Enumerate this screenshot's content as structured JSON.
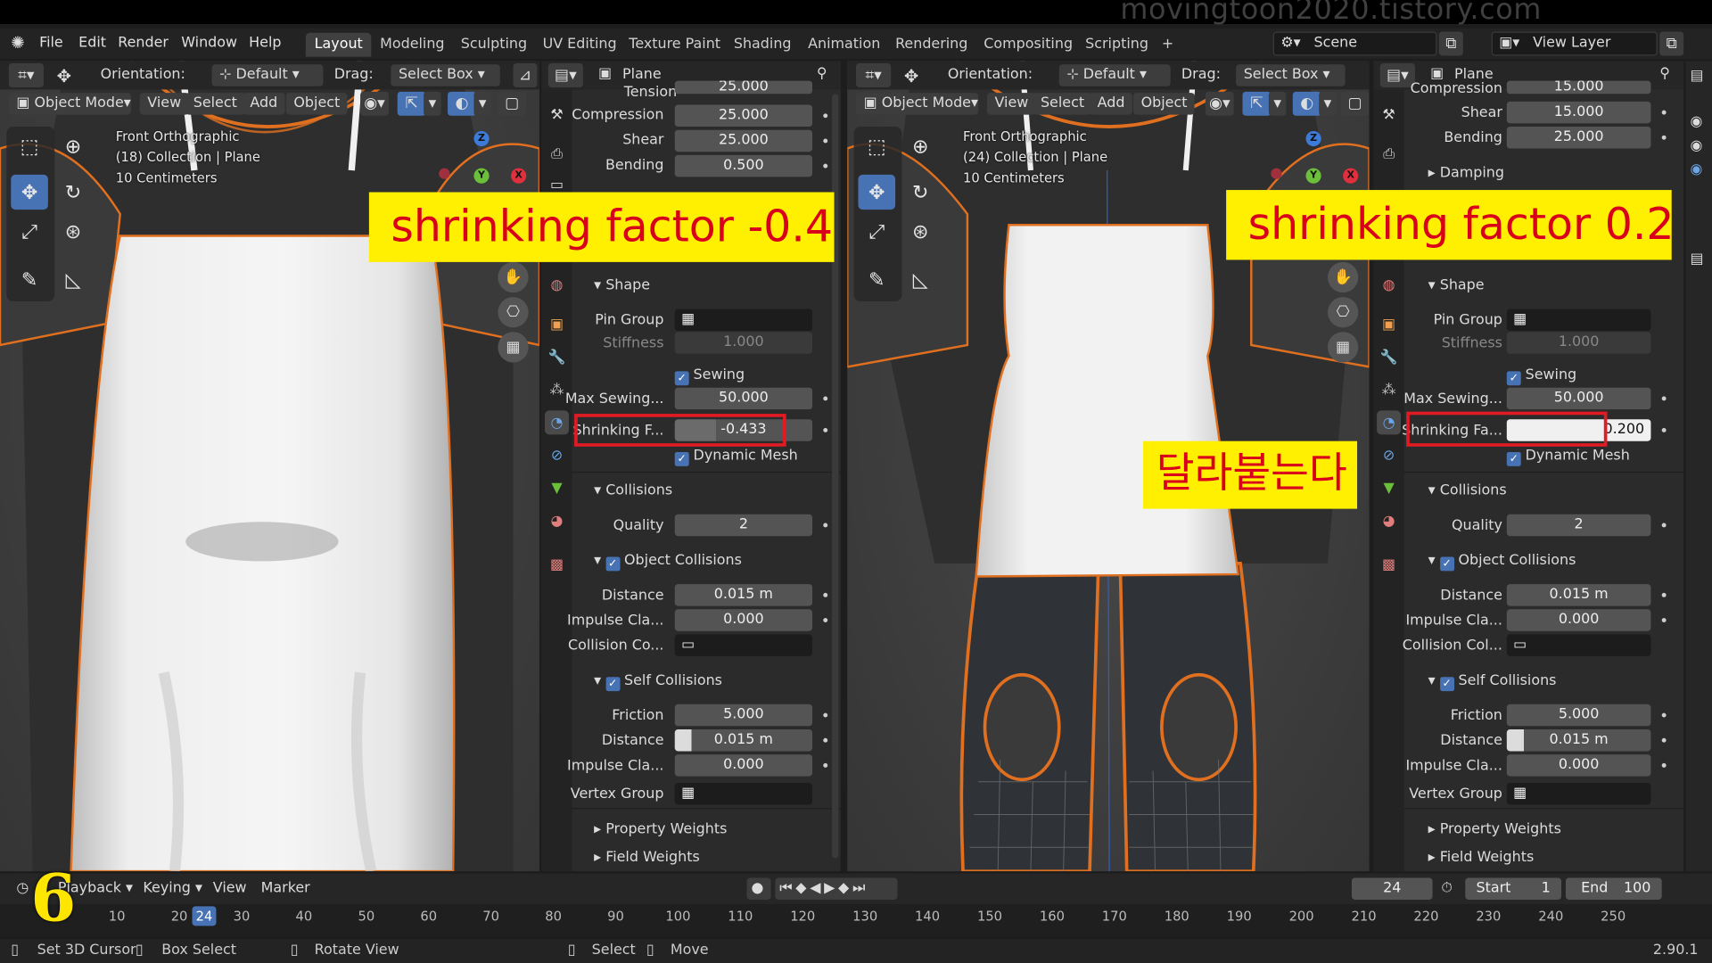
{
  "watermark": "movingtoon2020.tistory.com",
  "menu": {
    "file": "File",
    "edit": "Edit",
    "render": "Render",
    "window": "Window",
    "help": "Help"
  },
  "workspaces": [
    "Layout",
    "Modeling",
    "Sculpting",
    "UV Editing",
    "Texture Paint",
    "Shading",
    "Animation",
    "Rendering",
    "Compositing",
    "Scripting"
  ],
  "scene": {
    "label": "Scene",
    "view_layer": "View Layer"
  },
  "viewport_header": {
    "orientation_label": "Orientation:",
    "orientation_value": "Default",
    "drag_label": "Drag:",
    "drag_value": "Select Box",
    "mode": "Object Mode",
    "view": "View",
    "select": "Select",
    "add": "Add",
    "object": "Object"
  },
  "left_viewport": {
    "line1": "Front Orthographic",
    "line2": "(18) Collection | Plane",
    "line3": "10 Centimeters"
  },
  "right_viewport": {
    "line1": "Front Orthographic",
    "line2": "(24) Collection | Plane",
    "line3": "10 Centimeters"
  },
  "overlay": {
    "left_title": "shrinking factor   -0.4",
    "right_title": "shrinking factor   0.2",
    "korean_note": "달라붙는다"
  },
  "props_left": {
    "object_name": "Plane",
    "tension_label": "Tension",
    "tension": "25.000",
    "compression_label": "Compression",
    "compression": "25.000",
    "shear_label": "Shear",
    "shear": "25.000",
    "bending_label": "Bending",
    "bending": "0.500",
    "shape_label": "Shape",
    "pin_group_label": "Pin Group",
    "stiffness_label": "Stiffness",
    "stiffness": "1.000",
    "sewing_label": "Sewing",
    "max_sewing_label": "Max Sewing...",
    "max_sewing": "50.000",
    "shrinking_label": "Shrinking F...",
    "shrinking": "-0.433",
    "dynamic_mesh_label": "Dynamic Mesh",
    "collisions_label": "Collisions",
    "quality_label": "Quality",
    "quality": "2",
    "object_collisions_label": "Object Collisions",
    "distance_label": "Distance",
    "distance": "0.015 m",
    "impulse_label": "Impulse Cla...",
    "impulse": "0.000",
    "collision_co_label": "Collision Co...",
    "self_collisions_label": "Self Collisions",
    "friction_label": "Friction",
    "friction": "5.000",
    "self_distance_label": "Distance",
    "self_distance": "0.015 m",
    "self_impulse_label": "Impulse Cla...",
    "self_impulse": "0.000",
    "vertex_group_label": "Vertex Group",
    "property_weights_label": "Property Weights",
    "field_weights_label": "Field Weights"
  },
  "props_right": {
    "object_name": "Plane",
    "compression_label": "Compression",
    "compression": "15.000",
    "shear_label": "Shear",
    "shear": "15.000",
    "bending_label": "Bending",
    "bending": "25.000",
    "damping_label": "Damping",
    "shape_label": "Shape",
    "pin_group_label": "Pin Group",
    "stiffness_label": "Stiffness",
    "stiffness": "1.000",
    "sewing_label": "Sewing",
    "max_sewing_label": "Max Sewing...",
    "max_sewing": "50.000",
    "shrinking_label": "Shrinking Fa...",
    "shrinking": "0.200",
    "dynamic_mesh_label": "Dynamic Mesh",
    "collisions_label": "Collisions",
    "quality_label": "Quality",
    "quality": "2",
    "object_collisions_label": "Object Collisions",
    "distance_label": "Distance",
    "distance": "0.015 m",
    "impulse_label": "Impulse Cla...",
    "impulse": "0.000",
    "collision_co_label": "Collision Col...",
    "self_collisions_label": "Self Collisions",
    "friction_label": "Friction",
    "friction": "5.000",
    "self_distance_label": "Distance",
    "self_distance": "0.015 m",
    "self_impulse_label": "Impulse Cla...",
    "self_impulse": "0.000",
    "vertex_group_label": "Vertex Group",
    "property_weights_label": "Property Weights",
    "field_weights_label": "Field Weights"
  },
  "timeline": {
    "playback": "Playback",
    "keying": "Keying",
    "view": "View",
    "marker": "Marker",
    "current_frame": "24",
    "start_label": "Start",
    "start": "1",
    "end_label": "End",
    "end": "100",
    "ticks": [
      "10",
      "20",
      "24",
      "30",
      "40",
      "50",
      "60",
      "70",
      "80",
      "90",
      "100",
      "110",
      "120",
      "130",
      "140",
      "150",
      "160",
      "170",
      "180",
      "190",
      "200",
      "210",
      "220",
      "230",
      "240",
      "250"
    ]
  },
  "status": {
    "set_cursor": "Set 3D Cursor",
    "box_select": "Box Select",
    "rotate_view": "Rotate View",
    "select": "Select",
    "move": "Move",
    "version": "2.90.1"
  },
  "step_number": "6"
}
